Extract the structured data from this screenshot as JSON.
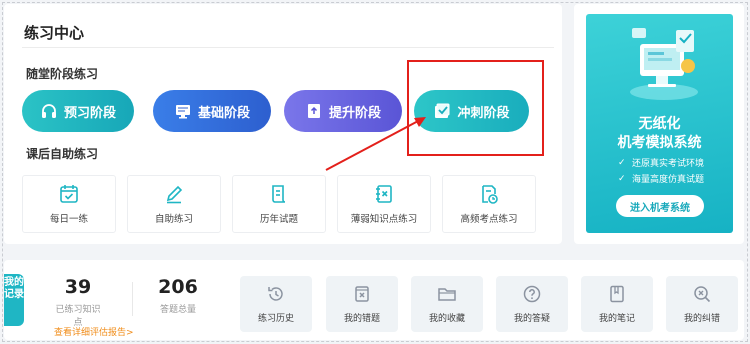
{
  "practice": {
    "title": "练习中心",
    "in_class_label": "随堂阶段练习",
    "stages": [
      {
        "label": "预习阶段",
        "icon": "headphones-icon"
      },
      {
        "label": "基础阶段",
        "icon": "monitor-icon"
      },
      {
        "label": "提升阶段",
        "icon": "upload-doc-icon"
      },
      {
        "label": "冲刺阶段",
        "icon": "checklist-icon"
      }
    ],
    "after_class_label": "课后自助练习",
    "tools": [
      {
        "label": "每日一练",
        "icon": "calendar-check-icon"
      },
      {
        "label": "自助练习",
        "icon": "pencil-icon"
      },
      {
        "label": "历年试题",
        "icon": "scroll-doc-icon"
      },
      {
        "label": "薄弱知识点练习",
        "icon": "book-x-icon"
      },
      {
        "label": "高频考点练习",
        "icon": "doc-clock-icon"
      }
    ]
  },
  "promo": {
    "title_line1": "无纸化",
    "title_line2": "机考模拟系统",
    "features": [
      "还原真实考试环境",
      "海量高度仿真试题"
    ],
    "button": "进入机考系统"
  },
  "records": {
    "tab_label": "我的记录",
    "stats": [
      {
        "value": "39",
        "label": "已练习知识点"
      },
      {
        "value": "206",
        "label": "答题总量"
      }
    ],
    "report_link": "查看详细评估报告>",
    "items": [
      {
        "label": "练习历史",
        "icon": "history-icon"
      },
      {
        "label": "我的错题",
        "icon": "wrong-book-icon"
      },
      {
        "label": "我的收藏",
        "icon": "folder-icon"
      },
      {
        "label": "我的答疑",
        "icon": "question-icon"
      },
      {
        "label": "我的笔记",
        "icon": "notebook-icon"
      },
      {
        "label": "我的纠错",
        "icon": "search-x-icon"
      }
    ]
  },
  "colors": {
    "teal": "#1fb6c4",
    "blue": "#2d5fcf",
    "purple": "#5a55d6",
    "annotation_red": "#e3201b",
    "link_orange": "#f08c19"
  }
}
